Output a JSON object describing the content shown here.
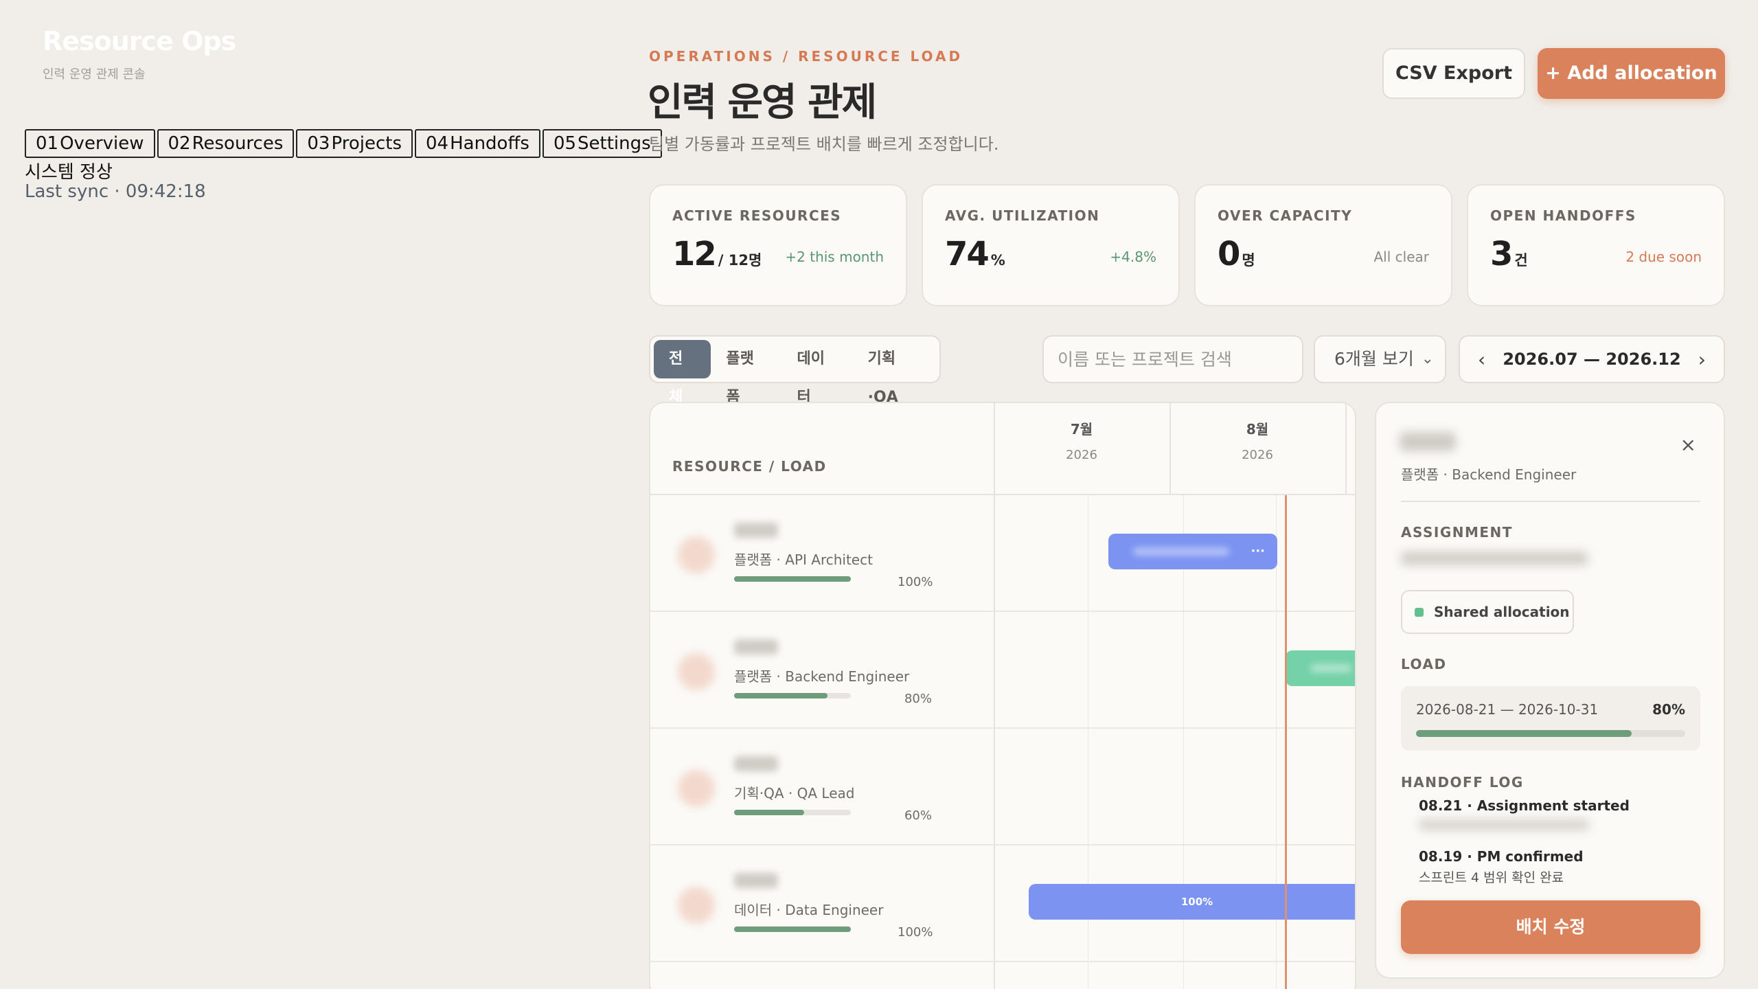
{
  "brand": {
    "title": "Resource Ops",
    "subtitle": "인력 운영 관제 콘솔"
  },
  "nav": [
    {
      "num": "01",
      "label": "Overview"
    },
    {
      "num": "02",
      "label": "Resources"
    },
    {
      "num": "03",
      "label": "Projects"
    },
    {
      "num": "04",
      "label": "Handoffs"
    },
    {
      "num": "05",
      "label": "Settings"
    }
  ],
  "status": {
    "system": "시스템 정상",
    "last_sync": "Last sync · 09:42:18"
  },
  "header": {
    "eyebrow": "OPERATIONS / RESOURCE LOAD",
    "title": "인력 운영 관제",
    "description": "팀별 가동률과 프로젝트 배치를 빠르게 조정합니다.",
    "csv_label": "CSV Export",
    "add_label": "+ Add allocation"
  },
  "kpis": [
    {
      "label": "ACTIVE RESOURCES",
      "value": "12",
      "unit": "/ 12명",
      "note": "+2 this month",
      "note_color": "#5a9670"
    },
    {
      "label": "AVG. UTILIZATION",
      "value": "74",
      "unit": "%",
      "note": "+4.8%",
      "note_color": "#5a9670"
    },
    {
      "label": "OVER CAPACITY",
      "value": "0",
      "unit": "명",
      "note": "All clear",
      "note_color": "#8c8882"
    },
    {
      "label": "OPEN HANDOFFS",
      "value": "3",
      "unit": "건",
      "note": "2 due soon",
      "note_color": "#d67a55"
    }
  ],
  "filters": {
    "segments": [
      "전체",
      "플랫폼",
      "데이터",
      "기획·QA"
    ],
    "active_segment": "전체",
    "search_placeholder": "이름 또는 프로젝트 검색",
    "range_option": "6개월 보기",
    "date_range": "2026.07 — 2026.12",
    "prev_label": "‹",
    "next_label": "›"
  },
  "timeline": {
    "header_label": "RESOURCE / LOAD",
    "months": [
      {
        "month": "7월",
        "year": "2026"
      },
      {
        "month": "8월",
        "year": "2026"
      }
    ],
    "rows": [
      {
        "meta": "플랫폼 · API Architect",
        "load": 100,
        "load_label": "100%",
        "bar": {
          "color": "#7c93f2",
          "text": "",
          "more": "···"
        }
      },
      {
        "meta": "플랫폼 · Backend Engineer",
        "load": 80,
        "load_label": "80%",
        "bar": {
          "color": "#74d1a8",
          "text": "",
          "more": ""
        }
      },
      {
        "meta": "기획·QA · QA Lead",
        "load": 60,
        "load_label": "60%",
        "bar": null
      },
      {
        "meta": "데이터 · Data Engineer",
        "load": 100,
        "load_label": "100%",
        "bar": {
          "color": "#7c93f2",
          "text": "100%",
          "more": ""
        }
      }
    ]
  },
  "detail": {
    "role": "플랫폼 · Backend Engineer",
    "close_icon": "×",
    "assignment_label": "ASSIGNMENT",
    "badge_label": "Shared allocation",
    "load_label": "LOAD",
    "load_range": "2026-08-21 — 2026-10-31",
    "load_pct_label": "80%",
    "load_pct": 80,
    "handoff_label": "HANDOFF LOG",
    "log": [
      {
        "title": "08.21 · Assignment started",
        "sub": ""
      },
      {
        "title": "08.19 · PM confirmed",
        "sub": "스프린트 4 범위 확인 완료"
      }
    ],
    "edit_label": "배치 수정"
  }
}
